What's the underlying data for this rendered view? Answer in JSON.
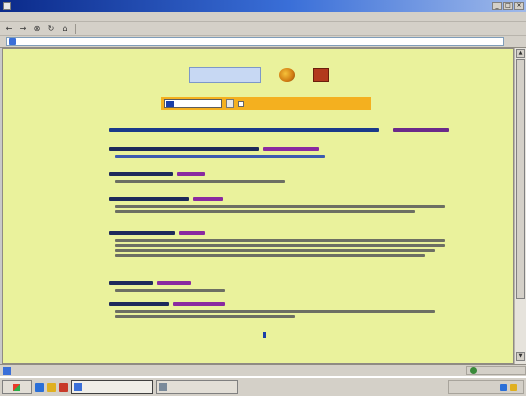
{
  "window": {
    "title": "",
    "min": "_",
    "max": "□",
    "close": "×"
  },
  "menubar": {
    "items": [
      "",
      "",
      "",
      "",
      "",
      "",
      ""
    ]
  },
  "toolbar": {
    "back": "←",
    "forward": "→",
    "stop": "⊗",
    "refresh": "↻",
    "home": "⌂",
    "text1": "",
    "text2": "",
    "text3": ""
  },
  "addressbar": {
    "label": "",
    "url": "",
    "go": "",
    "links": ""
  },
  "search": {
    "button": "",
    "option": ""
  },
  "summary": {
    "links": ""
  },
  "results": [
    {
      "title_w": 150,
      "tag_w": 56,
      "lines": [
        210
      ]
    },
    {
      "title_w": 64,
      "tag_w": 28,
      "lines": [
        170
      ]
    },
    {
      "title_w": 80,
      "tag_w": 30,
      "lines": [
        330,
        300
      ]
    },
    {
      "title_w": 66,
      "tag_w": 26,
      "lines": [
        330,
        330,
        320,
        310
      ]
    },
    {
      "title_w": 44,
      "tag_w": 34,
      "lines": [
        110
      ]
    },
    {
      "title_w": 60,
      "tag_w": 52,
      "lines": [
        320,
        180
      ]
    }
  ],
  "pagination": {
    "current": "1"
  },
  "statusbar": {
    "text": "",
    "zone": ""
  },
  "taskbar": {
    "start": "",
    "task1": "",
    "task2": "",
    "clock": ""
  },
  "colors": {
    "page_bg": "#eaf29c",
    "search_bar": "#f4b01f",
    "title_blue": "#1b3a8a",
    "tag_purple": "#8a2aa0"
  }
}
